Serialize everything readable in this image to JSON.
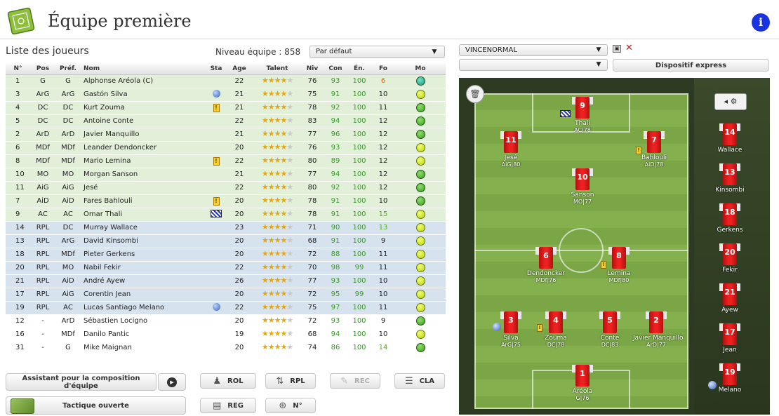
{
  "header": {
    "title": "Équipe première",
    "info_label": "i"
  },
  "list": {
    "title": "Liste des joueurs",
    "level_label": "Niveau équipe : 858",
    "sort_value": "Par défaut"
  },
  "columns": [
    "N°",
    "Pos",
    "Préf.",
    "Nom",
    "Sta",
    "Age",
    "Talent",
    "Niv",
    "Con",
    "Én.",
    "Fo",
    "Mo"
  ],
  "players": [
    {
      "num": "1",
      "pos": "G",
      "pref": "G",
      "name": "Alphonse Aréola (C)",
      "sta": "",
      "age": "22",
      "stars": 4,
      "niv": "76",
      "con": "93",
      "en": "100",
      "fo": "6",
      "fo_color": "orange",
      "mo": "teal",
      "group": "titular"
    },
    {
      "num": "3",
      "pos": "ArG",
      "pref": "ArG",
      "name": "Gastón Silva",
      "sta": "globe",
      "age": "21",
      "stars": 4,
      "niv": "75",
      "con": "91",
      "en": "100",
      "fo": "10",
      "fo_color": "",
      "mo": "lime",
      "group": "titular"
    },
    {
      "num": "4",
      "pos": "DC",
      "pref": "DC",
      "name": "Kurt Zouma",
      "sta": "alert",
      "age": "21",
      "stars": 4,
      "niv": "78",
      "con": "92",
      "en": "100",
      "fo": "11",
      "fo_color": "",
      "mo": "green",
      "group": "titular"
    },
    {
      "num": "5",
      "pos": "DC",
      "pref": "DC",
      "name": "Antoine Conte",
      "sta": "",
      "age": "22",
      "stars": 4,
      "niv": "83",
      "con": "94",
      "en": "100",
      "fo": "12",
      "fo_color": "",
      "mo": "green",
      "group": "titular"
    },
    {
      "num": "2",
      "pos": "ArD",
      "pref": "ArD",
      "name": "Javier Manquillo",
      "sta": "",
      "age": "21",
      "stars": 4,
      "niv": "77",
      "con": "96",
      "en": "100",
      "fo": "12",
      "fo_color": "",
      "mo": "green",
      "group": "titular"
    },
    {
      "num": "6",
      "pos": "MDf",
      "pref": "MDf",
      "name": "Leander Dendoncker",
      "sta": "",
      "age": "20",
      "stars": 4,
      "niv": "76",
      "con": "93",
      "en": "100",
      "fo": "12",
      "fo_color": "",
      "mo": "lime",
      "group": "titular"
    },
    {
      "num": "8",
      "pos": "MDf",
      "pref": "MDf",
      "name": "Mario Lemina",
      "sta": "alert",
      "age": "22",
      "stars": 4,
      "niv": "80",
      "con": "89",
      "en": "100",
      "fo": "12",
      "fo_color": "",
      "mo": "lime",
      "group": "titular"
    },
    {
      "num": "10",
      "pos": "MO",
      "pref": "MO",
      "name": "Morgan Sanson",
      "sta": "",
      "age": "21",
      "stars": 4,
      "niv": "77",
      "con": "94",
      "en": "100",
      "fo": "12",
      "fo_color": "",
      "mo": "green",
      "group": "titular"
    },
    {
      "num": "11",
      "pos": "AiG",
      "pref": "AiG",
      "name": "Jesé",
      "sta": "",
      "age": "22",
      "stars": 4,
      "niv": "80",
      "con": "92",
      "en": "100",
      "fo": "12",
      "fo_color": "",
      "mo": "green",
      "group": "titular"
    },
    {
      "num": "7",
      "pos": "AiD",
      "pref": "AiD",
      "name": "Fares Bahlouli",
      "sta": "alert",
      "age": "20",
      "stars": 4,
      "niv": "78",
      "con": "91",
      "en": "100",
      "fo": "10",
      "fo_color": "",
      "mo": "green",
      "group": "titular"
    },
    {
      "num": "9",
      "pos": "AC",
      "pref": "AC",
      "name": "Omar Thali",
      "sta": "flag",
      "age": "20",
      "stars": 4,
      "niv": "78",
      "con": "91",
      "en": "100",
      "fo": "15",
      "fo_color": "green",
      "mo": "lime",
      "group": "titular"
    },
    {
      "num": "14",
      "pos": "RPL",
      "pref": "DC",
      "name": "Murray Wallace",
      "sta": "",
      "age": "23",
      "stars": 4,
      "niv": "71",
      "con": "90",
      "en": "100",
      "fo": "13",
      "fo_color": "green",
      "mo": "lime",
      "group": "reserve"
    },
    {
      "num": "13",
      "pos": "RPL",
      "pref": "ArG",
      "name": "David Kinsombi",
      "sta": "",
      "age": "20",
      "stars": 4,
      "niv": "68",
      "con": "91",
      "en": "100",
      "fo": "9",
      "fo_color": "",
      "mo": "lime",
      "group": "reserve"
    },
    {
      "num": "18",
      "pos": "RPL",
      "pref": "MDf",
      "name": "Pieter Gerkens",
      "sta": "",
      "age": "20",
      "stars": 4,
      "niv": "72",
      "con": "88",
      "en": "100",
      "fo": "11",
      "fo_color": "",
      "mo": "lime",
      "group": "reserve"
    },
    {
      "num": "20",
      "pos": "RPL",
      "pref": "MO",
      "name": "Nabil Fekir",
      "sta": "",
      "age": "22",
      "stars": 4,
      "niv": "70",
      "con": "98",
      "en": "99",
      "fo": "11",
      "fo_color": "",
      "mo": "lime",
      "group": "reserve"
    },
    {
      "num": "21",
      "pos": "RPL",
      "pref": "AiD",
      "name": "André Ayew",
      "sta": "",
      "age": "26",
      "stars": 4,
      "niv": "77",
      "con": "93",
      "en": "100",
      "fo": "10",
      "fo_color": "",
      "mo": "lime",
      "group": "reserve"
    },
    {
      "num": "17",
      "pos": "RPL",
      "pref": "AiG",
      "name": "Corentin Jean",
      "sta": "",
      "age": "20",
      "stars": 4,
      "niv": "72",
      "con": "95",
      "en": "99",
      "fo": "10",
      "fo_color": "",
      "mo": "lime",
      "group": "reserve"
    },
    {
      "num": "19",
      "pos": "RPL",
      "pref": "AC",
      "name": "Lucas Santiago Melano",
      "sta": "globe",
      "age": "22",
      "stars": 4,
      "niv": "75",
      "con": "97",
      "en": "100",
      "fo": "11",
      "fo_color": "",
      "mo": "lime",
      "group": "reserve"
    },
    {
      "num": "12",
      "pos": "-",
      "pref": "ArD",
      "name": "Sébastien Locigno",
      "sta": "",
      "age": "20",
      "stars": 4,
      "niv": "72",
      "con": "93",
      "en": "100",
      "fo": "9",
      "fo_color": "",
      "mo": "green",
      "group": "other"
    },
    {
      "num": "16",
      "pos": "-",
      "pref": "MDf",
      "name": "Danilo Pantic",
      "sta": "",
      "age": "19",
      "stars": 4,
      "niv": "68",
      "con": "94",
      "en": "100",
      "fo": "10",
      "fo_color": "",
      "mo": "lime",
      "group": "other"
    },
    {
      "num": "31",
      "pos": "-",
      "pref": "G",
      "name": "Mike Maignan",
      "sta": "",
      "age": "20",
      "stars": 4,
      "niv": "74",
      "con": "86",
      "en": "100",
      "fo": "14",
      "fo_color": "green",
      "mo": "green",
      "group": "other"
    }
  ],
  "buttons": {
    "assist": "Assistant pour la composition d'équipe",
    "tactic": "Tactique ouverte",
    "rol": "ROL",
    "rpl": "RPL",
    "rec": "REC",
    "cla": "CLA",
    "reg": "REG",
    "num": "N°",
    "express": "Dispositif express"
  },
  "coach_select": "VINCENORMAL",
  "pitch": {
    "players": [
      {
        "num": "9",
        "name": "Thali",
        "role": "AC|78",
        "badge": "flag"
      },
      {
        "num": "11",
        "name": "Jesé",
        "role": "AiG|80",
        "badge": ""
      },
      {
        "num": "7",
        "name": "Bahlouli",
        "role": "AiD|78",
        "badge": "alert"
      },
      {
        "num": "10",
        "name": "Sanson",
        "role": "MO|77",
        "badge": ""
      },
      {
        "num": "6",
        "name": "Dendoncker",
        "role": "MDf|76",
        "badge": ""
      },
      {
        "num": "8",
        "name": "Lemina",
        "role": "MDf|80",
        "badge": "alert"
      },
      {
        "num": "3",
        "name": "Silva",
        "role": "ArG|75",
        "badge": "globe"
      },
      {
        "num": "4",
        "name": "Zouma",
        "role": "DC|78",
        "badge": "alert"
      },
      {
        "num": "5",
        "name": "Conte",
        "role": "DC|83",
        "badge": ""
      },
      {
        "num": "2",
        "name": "Javier Manquillo",
        "role": "ArD|77",
        "badge": ""
      },
      {
        "num": "1",
        "name": "Aréola",
        "role": "G|76",
        "badge": ""
      }
    ],
    "bench": [
      {
        "num": "14",
        "name": "Wallace",
        "badge": ""
      },
      {
        "num": "13",
        "name": "Kinsombi",
        "badge": ""
      },
      {
        "num": "18",
        "name": "Gerkens",
        "badge": ""
      },
      {
        "num": "20",
        "name": "Fekir",
        "badge": ""
      },
      {
        "num": "21",
        "name": "Ayew",
        "badge": ""
      },
      {
        "num": "17",
        "name": "Jean",
        "badge": ""
      },
      {
        "num": "19",
        "name": "Melano",
        "badge": "globe"
      }
    ]
  },
  "colors": {
    "titular_row": "#e2efd9",
    "reserve_row": "#d6e2ee",
    "info_blue": "#1a33e0",
    "shirt_red": "#e82020"
  }
}
